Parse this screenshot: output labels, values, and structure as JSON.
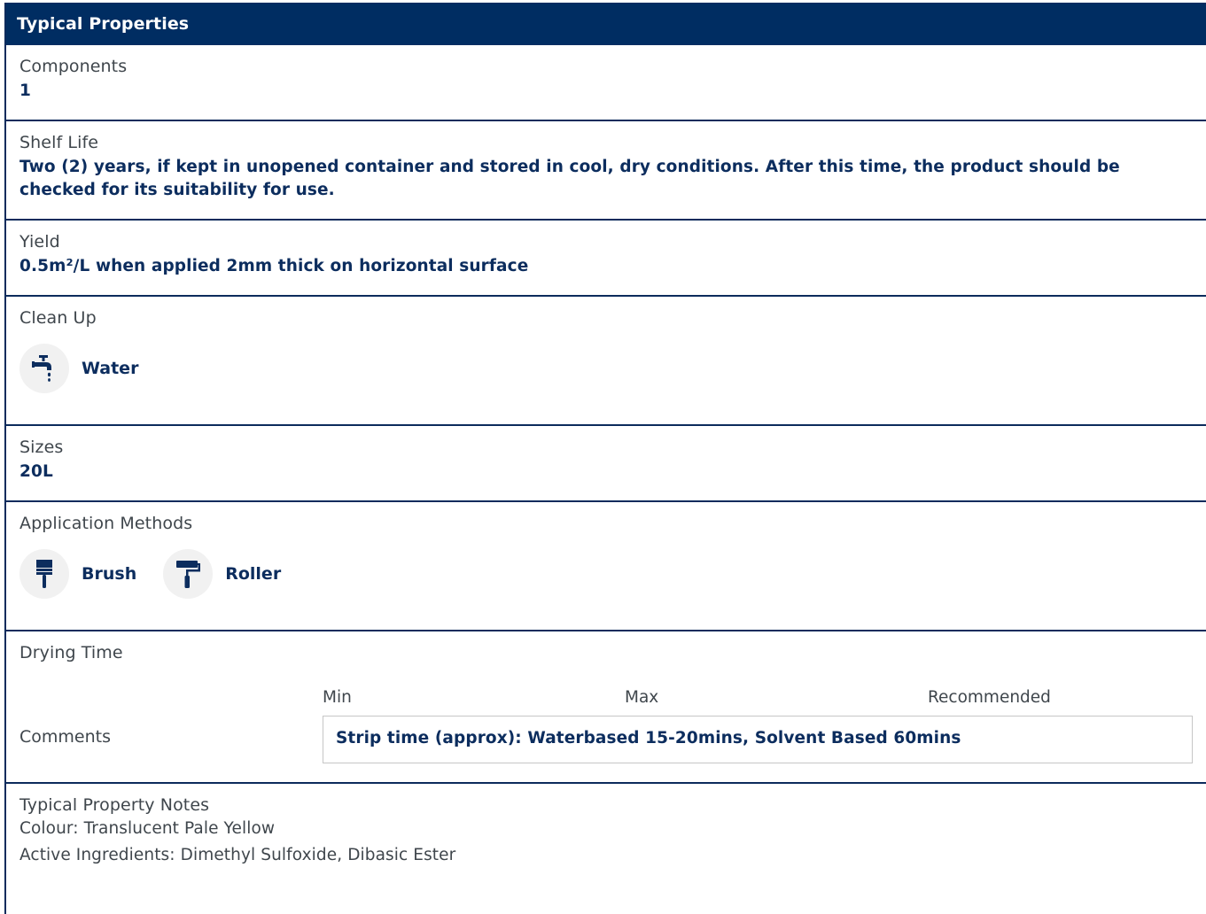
{
  "header": {
    "title": "Typical Properties"
  },
  "components": {
    "label": "Components",
    "value": "1"
  },
  "shelf_life": {
    "label": "Shelf Life",
    "value": "Two (2) years, if kept in unopened container and stored in cool, dry conditions. After this time, the product should be checked for its suitability for use."
  },
  "yield": {
    "label": "Yield",
    "value": "0.5m²/L when applied 2mm thick on horizontal surface"
  },
  "clean_up": {
    "label": "Clean Up",
    "items": [
      {
        "icon": "tap-water-icon",
        "label": "Water"
      }
    ]
  },
  "sizes": {
    "label": "Sizes",
    "value": "20L"
  },
  "application_methods": {
    "label": "Application Methods",
    "items": [
      {
        "icon": "brush-icon",
        "label": "Brush"
      },
      {
        "icon": "roller-icon",
        "label": "Roller"
      }
    ]
  },
  "drying_time": {
    "label": "Drying Time",
    "columns": [
      "Min",
      "Max",
      "Recommended"
    ],
    "comments_label": "Comments",
    "comments": "Strip time (approx): Waterbased 15-20mins, Solvent Based 60mins"
  },
  "notes": {
    "label": "Typical Property Notes",
    "lines": [
      "Colour: Translucent Pale Yellow",
      "Active Ingredients: Dimethyl Sulfoxide, Dibasic Ester"
    ]
  },
  "colors": {
    "header_bg": "#002d62",
    "value_text": "#0c2d5e",
    "divider": "#0c2b5c",
    "icon_bg": "#f1f1f1"
  }
}
